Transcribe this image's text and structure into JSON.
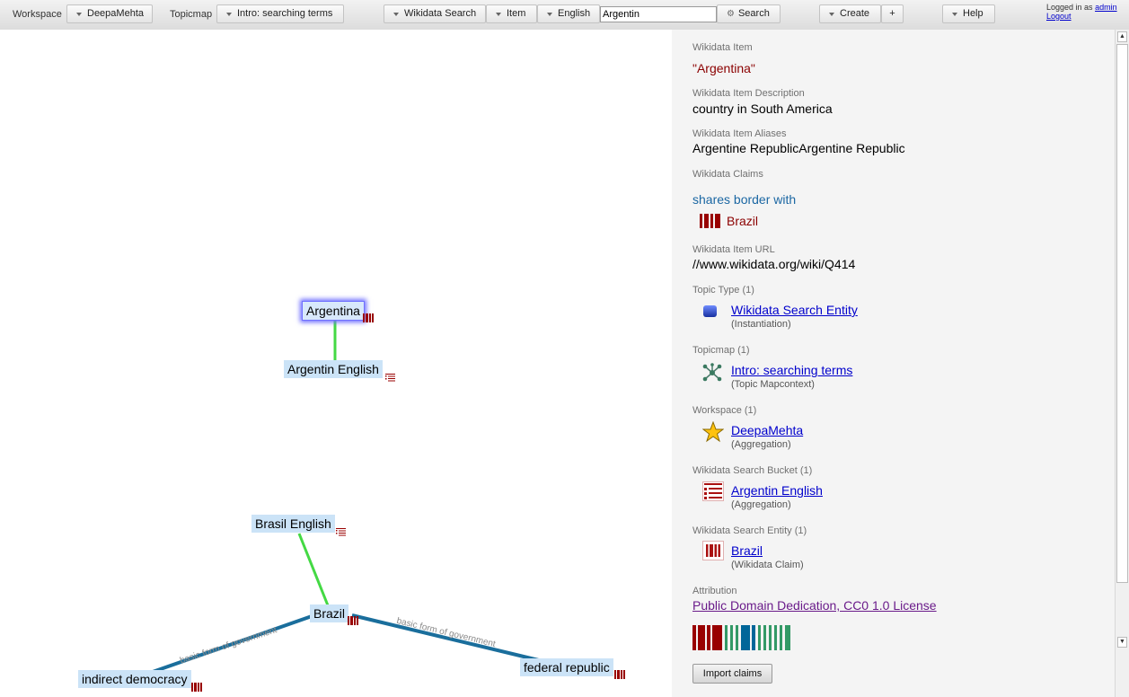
{
  "toolbar": {
    "workspace_label": "Workspace",
    "workspace_value": "DeepaMehta",
    "topicmap_label": "Topicmap",
    "topicmap_value": "Intro: searching terms",
    "search_type": "Wikidata Search",
    "search_entity": "Item",
    "search_language": "English",
    "search_query": "Argentin",
    "search_button": "Search",
    "create_button": "Create",
    "plus_button": "+",
    "help_button": "Help"
  },
  "login": {
    "text": "Logged in as",
    "user": "admin",
    "logout": "Logout"
  },
  "canvas": {
    "topics": {
      "argentina": "Argentina",
      "argentin_english": "Argentin English",
      "brasil_english": "Brasil English",
      "brazil": "Brazil",
      "indirect_democracy": "indirect democracy",
      "federal_republic": "federal republic"
    },
    "edge_labels": {
      "left": "basic form of government",
      "right": "basic form of government"
    },
    "colors": {
      "instantiation_edge": "#44d944",
      "claim_edge": "#1a6e9c",
      "topic_bg": "#cbe3f7",
      "selection_glow": "#6f6fff"
    }
  },
  "detail": {
    "item_label": "Wikidata Item",
    "item_value": "\"Argentina\"",
    "description_label": "Wikidata Item Description",
    "description_value": "country in South America",
    "aliases_label": "Wikidata Item Aliases",
    "aliases_value": "Argentine RepublicArgentine Republic",
    "claims_label": "Wikidata Claims",
    "claim_property": "shares border with",
    "claim_value": "Brazil",
    "url_label": "Wikidata Item URL",
    "url_value": "//www.wikidata.org/wiki/Q414",
    "topic_type_label": "Topic Type (1)",
    "topic_type_link": "Wikidata Search Entity",
    "topic_type_sub": "(Instantiation)",
    "topicmap_label": "Topicmap (1)",
    "topicmap_link": "Intro: searching terms",
    "topicmap_sub": "(Topic Mapcontext)",
    "workspace_label": "Workspace (1)",
    "workspace_link": "DeepaMehta",
    "workspace_sub": "(Aggregation)",
    "bucket_label": "Wikidata Search Bucket (1)",
    "bucket_link": "Argentin English",
    "bucket_sub": "(Aggregation)",
    "entity_label": "Wikidata Search Entity (1)",
    "entity_link": "Brazil",
    "entity_sub": "(Wikidata Claim)",
    "attribution_label": "Attribution",
    "attribution_link": "Public Domain Dedication, CC0 1.0 License",
    "import_button": "Import claims"
  }
}
